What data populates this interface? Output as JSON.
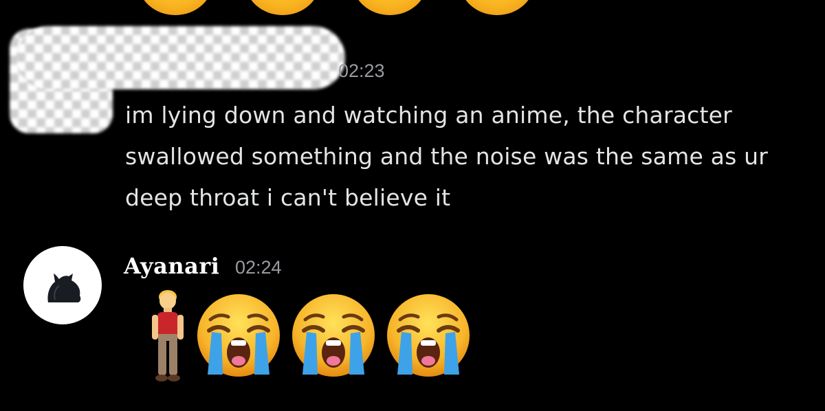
{
  "messages": [
    {
      "author": "",
      "timestamp": "02:23",
      "text": "im lying down and watching an anime, the character swallowed something and the noise was the same as ur deep throat i can't believe it"
    },
    {
      "author": "Ayanari",
      "timestamp": "02:24",
      "emojis": [
        "person-standing-icon",
        "loudly-crying-face-icon",
        "loudly-crying-face-icon",
        "loudly-crying-face-icon"
      ]
    }
  ],
  "colors": {
    "background": "#000000",
    "text": "#e3e4e6",
    "timestamp": "#9a9ca3",
    "username": "#ffffff"
  }
}
